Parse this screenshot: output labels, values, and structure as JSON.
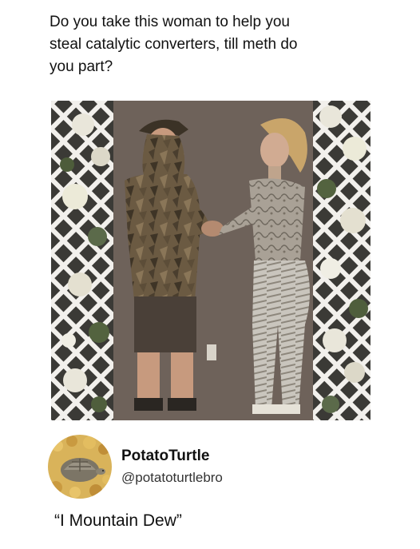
{
  "post": {
    "text": "Do you take this woman to help you\nsteal catalytic converters, till meth do\nyou part?"
  },
  "photo": {
    "alt_subject": "couple holding hands in front of lattice and flowers"
  },
  "author": {
    "name": "PotatoTurtle",
    "handle": "@potatoturtlebro",
    "avatar_icon": "turtle-avatar-icon"
  },
  "reply": {
    "text": "“I Mountain Dew”"
  },
  "colors": {
    "background": "#ffffff",
    "text": "#111111",
    "wall": "#6e625a",
    "lattice": "#f2f0ec"
  }
}
